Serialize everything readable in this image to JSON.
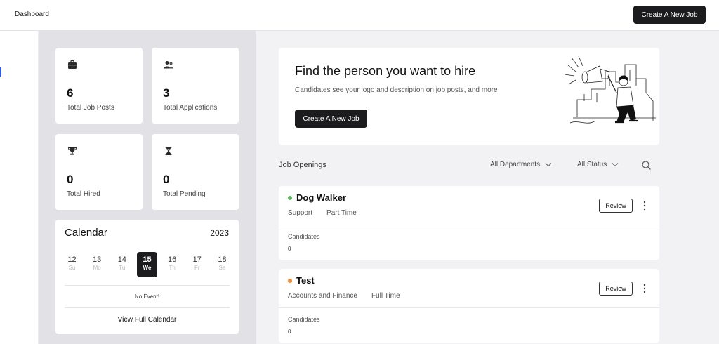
{
  "header": {
    "breadcrumb": "Dashboard",
    "create_job_label": "Create A New Job"
  },
  "stats": [
    {
      "value": "6",
      "label": "Total Job Posts",
      "icon": "briefcase-icon"
    },
    {
      "value": "3",
      "label": "Total Applications",
      "icon": "users-icon"
    },
    {
      "value": "0",
      "label": "Total Hired",
      "icon": "trophy-icon"
    },
    {
      "value": "0",
      "label": "Total Pending",
      "icon": "hourglass-icon"
    }
  ],
  "calendar": {
    "title": "Calendar",
    "year": "2023",
    "days": [
      {
        "num": "12",
        "wd": "Su"
      },
      {
        "num": "13",
        "wd": "Mo"
      },
      {
        "num": "14",
        "wd": "Tu"
      },
      {
        "num": "15",
        "wd": "We"
      },
      {
        "num": "16",
        "wd": "Th"
      },
      {
        "num": "17",
        "wd": "Fr"
      },
      {
        "num": "18",
        "wd": "Sa"
      }
    ],
    "selected_day": "15",
    "no_event": "No Event!",
    "view_full": "View Full Calendar"
  },
  "hero": {
    "title": "Find the person you want to hire",
    "subtitle": "Candidates see your logo and description on job posts, and more",
    "button": "Create A New Job",
    "illustration": "megaphone-person-illustration"
  },
  "openings": {
    "title": "Job Openings",
    "department_filter": "All Departments",
    "status_filter": "All Status",
    "search_icon": "search-icon"
  },
  "jobs": [
    {
      "title": "Dog Walker",
      "status_color": "#5cb85c",
      "department": "Support",
      "type": "Part Time",
      "review": "Review",
      "candidates_label": "Candidates",
      "candidates": "0"
    },
    {
      "title": "Test",
      "status_color": "#f0892b",
      "department": "Accounts and Finance",
      "type": "Full Time",
      "review": "Review",
      "candidates_label": "Candidates",
      "candidates": "0"
    }
  ],
  "colors": {
    "accent_dark": "#1c1c1e",
    "left_panel_bg": "#e2e2e6",
    "page_bg": "#f2f2f4"
  }
}
